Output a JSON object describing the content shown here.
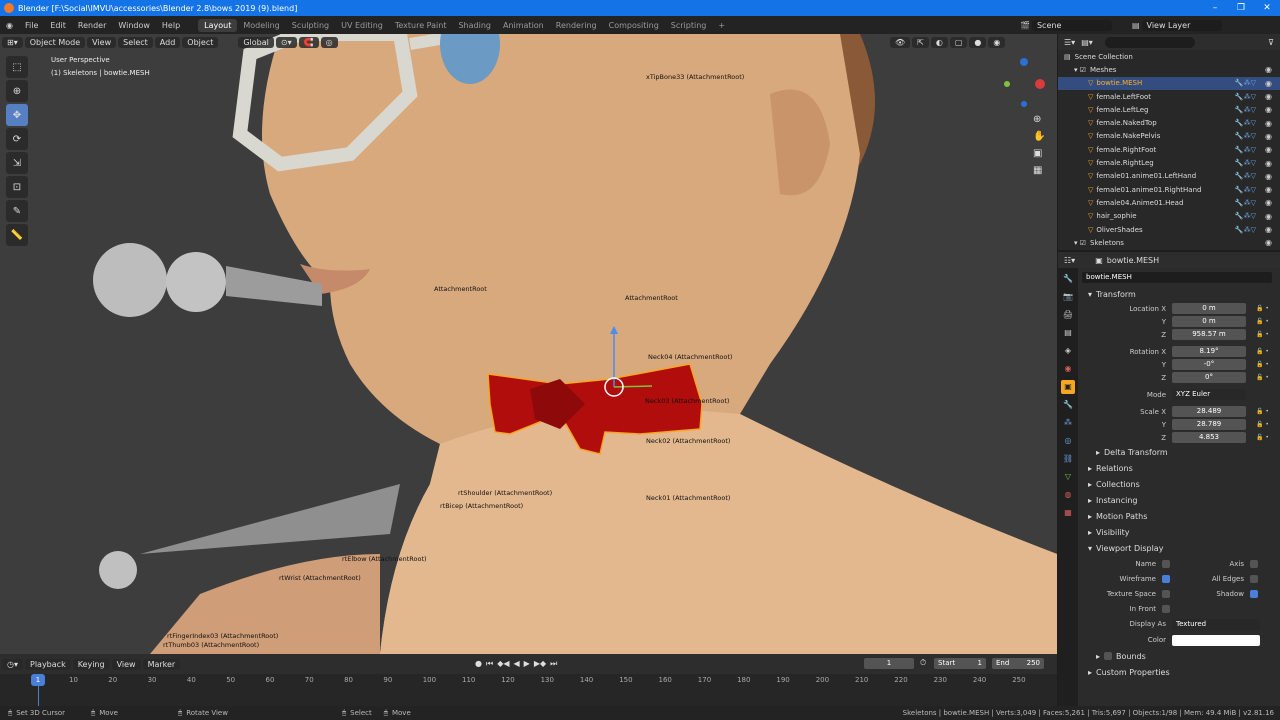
{
  "window": {
    "title": "Blender [F:\\Social\\IMVU\\accessories\\Blender 2.8\\bows 2019 (9).blend]"
  },
  "menu": [
    "File",
    "Edit",
    "Render",
    "Window",
    "Help"
  ],
  "workspaces": [
    {
      "label": "Layout",
      "active": true
    },
    {
      "label": "Modeling"
    },
    {
      "label": "Sculpting"
    },
    {
      "label": "UV Editing"
    },
    {
      "label": "Texture Paint"
    },
    {
      "label": "Shading"
    },
    {
      "label": "Animation"
    },
    {
      "label": "Rendering"
    },
    {
      "label": "Compositing"
    },
    {
      "label": "Scripting"
    }
  ],
  "scene": {
    "name": "Scene",
    "view_layer": "View Layer"
  },
  "viewport": {
    "mode": "Object Mode",
    "menus": [
      "View",
      "Select",
      "Add",
      "Object"
    ],
    "orientation": "Global",
    "overlay_line1": "User Perspective",
    "overlay_line2": "(1) Skeletons | bowtie.MESH",
    "bone_labels": [
      "xTipBone33 (AttachmentRoot)",
      "AttachmentRoot",
      "AttachmentRoot",
      "Neck04 (AttachmentRoot)",
      "Neck03 (AttachmentRoot)",
      "Neck02 (AttachmentRoot)",
      "Neck01 (AttachmentRoot)",
      "rtShoulder (AttachmentRoot)",
      "rtBicep (AttachmentRoot)",
      "rtElbow (AttachmentRoot)",
      "rtWrist (AttachmentRoot)",
      "rtFingerIndex03 (AttachmentRoot)",
      "rtThumb03 (AttachmentRoot)"
    ]
  },
  "outliner": {
    "root": "Scene Collection",
    "collection": "Meshes",
    "items": [
      "bowtie.MESH",
      "female.LeftFoot",
      "female.LeftLeg",
      "female.NakedTop",
      "female.NakePelvis",
      "female.RightFoot",
      "female.RightLeg",
      "female01.anime01.LeftHand",
      "female01.anime01.RightHand",
      "female04.Anime01.Head",
      "hair_sophie",
      "OliverShades"
    ],
    "selected_index": 0,
    "skeletons": "Skeletons"
  },
  "properties": {
    "object_name": "bowtie.MESH",
    "data_name": "bowtie.MESH",
    "transform": {
      "header": "Transform",
      "location_label": "Location X",
      "loc": [
        "0 m",
        "0 m",
        "958.57 m"
      ],
      "rotation_label": "Rotation X",
      "rot": [
        "8.19°",
        "-0°",
        "0°"
      ],
      "mode_label": "Mode",
      "mode": "XYZ Euler",
      "scale_label": "Scale X",
      "scale": [
        "28.489",
        "28.789",
        "4.853"
      ],
      "y": "Y",
      "z": "Z"
    },
    "delta": "Delta Transform",
    "sections": [
      "Relations",
      "Collections",
      "Instancing",
      "Motion Paths",
      "Visibility"
    ],
    "viewport_display": {
      "header": "Viewport Display",
      "name": "Name",
      "axis": "Axis",
      "wireframe": "Wireframe",
      "all_edges": "All Edges",
      "texture_space": "Texture Space",
      "shadow": "Shadow",
      "in_front": "In Front",
      "display_as_label": "Display As",
      "display_as": "Textured",
      "color_label": "Color",
      "bounds": "Bounds"
    },
    "custom": "Custom Properties"
  },
  "timeline": {
    "menus": [
      "Playback",
      "Keying",
      "View",
      "Marker"
    ],
    "current_frame": "1",
    "start_label": "Start",
    "start": "1",
    "end_label": "End",
    "end": "250",
    "ticks": [
      "10",
      "20",
      "30",
      "40",
      "50",
      "60",
      "70",
      "80",
      "90",
      "100",
      "110",
      "120",
      "130",
      "140",
      "150",
      "160",
      "170",
      "180",
      "190",
      "200",
      "210",
      "220",
      "230",
      "240",
      "250"
    ],
    "playhead": "1"
  },
  "status": {
    "left": [
      "Set 3D Cursor",
      "Move",
      "Rotate View",
      "Select",
      "Move"
    ],
    "right": "Skeletons | bowtie.MESH | Verts:3,049 | Faces:5,261 | Tris:5,697 | Objects:1/98 | Mem: 49.4 MiB | v2.81.16"
  }
}
